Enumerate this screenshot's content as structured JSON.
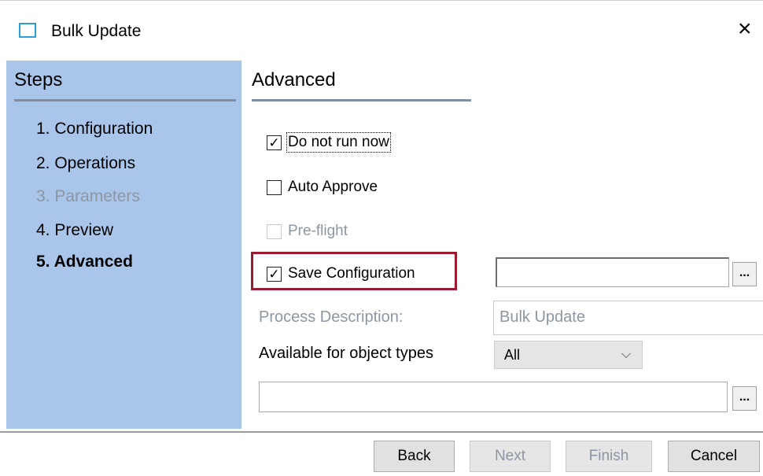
{
  "window": {
    "title": "Bulk Update",
    "app_icon": "window-icon",
    "close_glyph": "×"
  },
  "steps": {
    "title": "Steps",
    "items": [
      {
        "label": "1. Configuration",
        "state": "normal"
      },
      {
        "label": "2. Operations",
        "state": "normal"
      },
      {
        "label": "3. Parameters",
        "state": "disabled"
      },
      {
        "label": "4. Preview",
        "state": "normal"
      },
      {
        "label": "5. Advanced",
        "state": "current"
      }
    ]
  },
  "advanced": {
    "title": "Advanced",
    "options": {
      "do_not_run_now": {
        "label": "Do not run now",
        "checked": true,
        "enabled": true
      },
      "auto_approve": {
        "label": "Auto Approve",
        "checked": false,
        "enabled": true
      },
      "pre_flight": {
        "label": "Pre-flight",
        "checked": false,
        "enabled": false
      },
      "save_configuration": {
        "label": "Save Configuration",
        "checked": true,
        "enabled": true
      }
    },
    "save_config_path": {
      "value": "",
      "browse_label": "..."
    },
    "process_description": {
      "label": "Process Description:",
      "value": "Bulk Update"
    },
    "object_types": {
      "label": "Available for object types",
      "selected": "All"
    },
    "object_types_list": {
      "value": "",
      "browse_label": "..."
    }
  },
  "footer": {
    "back": "Back",
    "next": "Next",
    "finish": "Finish",
    "cancel": "Cancel"
  },
  "colors": {
    "steps_panel_bg": "#a9c6ea",
    "highlight_border": "#9b1b30",
    "disabled_text": "#8d96a3"
  }
}
